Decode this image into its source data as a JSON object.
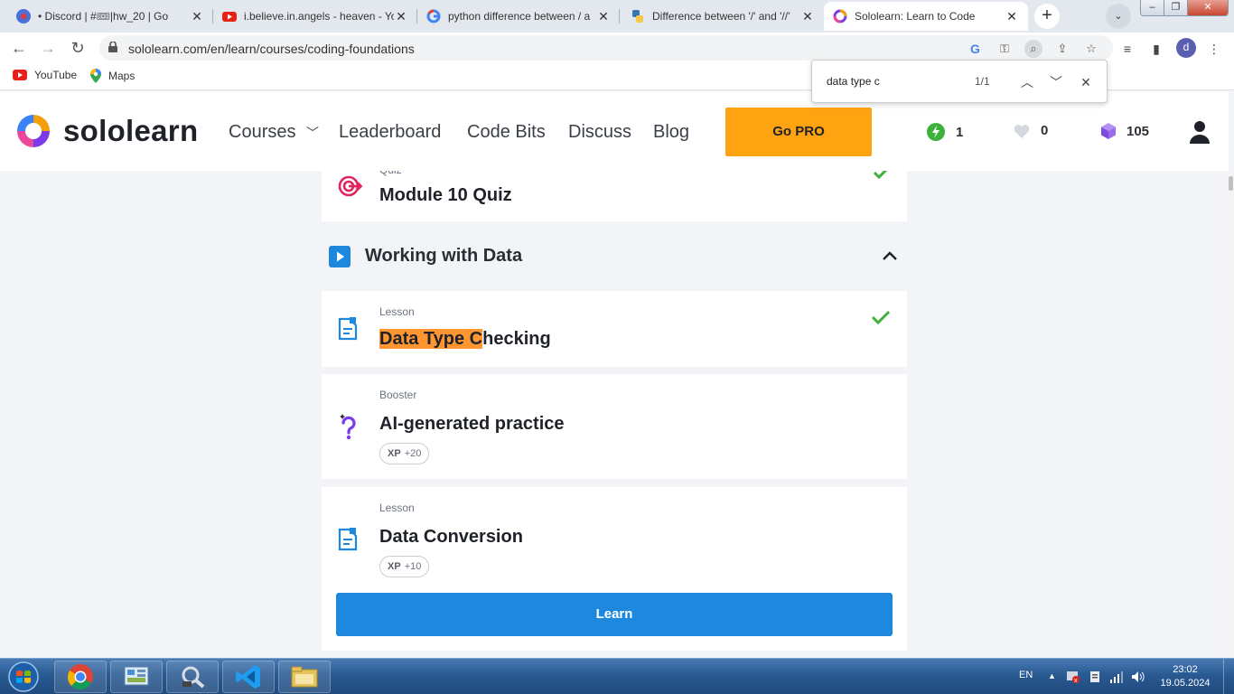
{
  "browser": {
    "tabs": [
      {
        "title": "• Discord | #🎟|hw_20 | Go",
        "active": false
      },
      {
        "title": "i.believe.in.angels - heaven - Yo",
        "active": false
      },
      {
        "title": "python difference between / a",
        "active": false
      },
      {
        "title": "Difference between '/' and '//'",
        "active": false
      },
      {
        "title": "Sololearn: Learn to Code",
        "active": true
      }
    ],
    "new_tab": "+",
    "url": "sololearn.com/en/learn/courses/coding-foundations",
    "profile_initial": "d",
    "bookmarks": [
      {
        "label": "YouTube",
        "icon": "youtube-icon"
      },
      {
        "label": "Maps",
        "icon": "maps-pin-icon"
      }
    ],
    "find": {
      "query": "data type c",
      "count": "1/1"
    }
  },
  "header": {
    "brand": "sololearn",
    "nav": [
      "Courses",
      "Leaderboard",
      "Code Bits",
      "Discuss",
      "Blog"
    ],
    "go_pro": "Go PRO",
    "streak": "1",
    "hearts": "0",
    "gems": "105",
    "colors": {
      "go_pro": "#ffa310",
      "streak": "#3cb13c"
    }
  },
  "content": {
    "quiz": {
      "kind": "Quiz",
      "title": "Module 10 Quiz",
      "completed": true
    },
    "module": {
      "title": "Working with Data",
      "expanded": true
    },
    "items": [
      {
        "kind": "Lesson",
        "title_highlight": "Data Type C",
        "title_rest": "hecking",
        "completed": true
      },
      {
        "kind": "Booster",
        "title": "AI-generated practice",
        "xp_label": "XP",
        "xp_value": "+20"
      },
      {
        "kind": "Lesson",
        "title": "Data Conversion",
        "xp_label": "XP",
        "xp_value": "+10"
      }
    ],
    "learn_button": "Learn",
    "colors": {
      "check": "#3cb13c",
      "learn": "#1e88df",
      "highlight": "#ff9632"
    }
  },
  "taskbar": {
    "language": "EN",
    "time": "23:02",
    "date": "19.05.2024"
  }
}
